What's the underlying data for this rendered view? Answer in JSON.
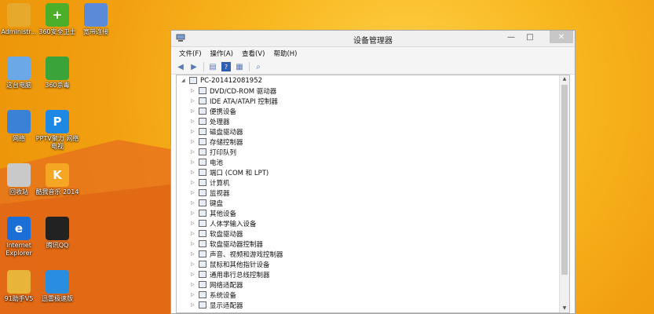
{
  "desktop": {
    "icons": [
      {
        "label": "Administr...",
        "glyph": "",
        "color": "#e6a92b"
      },
      {
        "label": "360安全卫士",
        "glyph": "+",
        "color": "#4caf2a"
      },
      {
        "label": "宽带连接",
        "glyph": "",
        "color": "#5a8ad8"
      },
      {
        "label": "这台电脑",
        "glyph": "",
        "color": "#6aa8e8"
      },
      {
        "label": "360杀毒",
        "glyph": "",
        "color": "#3aa33a"
      },
      {
        "label": "网络",
        "glyph": "",
        "color": "#3b82d6"
      },
      {
        "label": "PPTV聚力 网络电视",
        "glyph": "P",
        "color": "#1e88e5"
      },
      {
        "label": "回收站",
        "glyph": "",
        "color": "#c9c9c9"
      },
      {
        "label": "酷我音乐 2014",
        "glyph": "K",
        "color": "#f5a623"
      },
      {
        "label": "Internet Explorer",
        "glyph": "e",
        "color": "#1d6fd8"
      },
      {
        "label": "腾讯QQ",
        "glyph": "",
        "color": "#222"
      },
      {
        "label": "91助手V5",
        "glyph": "",
        "color": "#e8b53a"
      },
      {
        "label": "迅雷极速版",
        "glyph": "",
        "color": "#2a8ee0"
      }
    ]
  },
  "window": {
    "title": "设备管理器",
    "controls": {
      "minimize": "—",
      "maximize": "□",
      "close": "✕"
    },
    "menu": [
      "文件(F)",
      "操作(A)",
      "查看(V)",
      "帮助(H)"
    ],
    "toolbar_icons": [
      "back-icon",
      "forward-icon",
      "properties-icon",
      "help-icon",
      "view-icon",
      "scan-icon"
    ],
    "tree": {
      "root": "PC-201412081952",
      "children": [
        "DVD/CD-ROM 驱动器",
        "IDE ATA/ATAPI 控制器",
        "便携设备",
        "处理器",
        "磁盘驱动器",
        "存储控制器",
        "打印队列",
        "电池",
        "端口 (COM 和 LPT)",
        "计算机",
        "监视器",
        "键盘",
        "其他设备",
        "人体学输入设备",
        "软盘驱动器",
        "软盘驱动器控制器",
        "声音、视频和游戏控制器",
        "鼠标和其他指针设备",
        "通用串行总线控制器",
        "网络适配器",
        "系统设备",
        "显示适配器"
      ]
    }
  }
}
